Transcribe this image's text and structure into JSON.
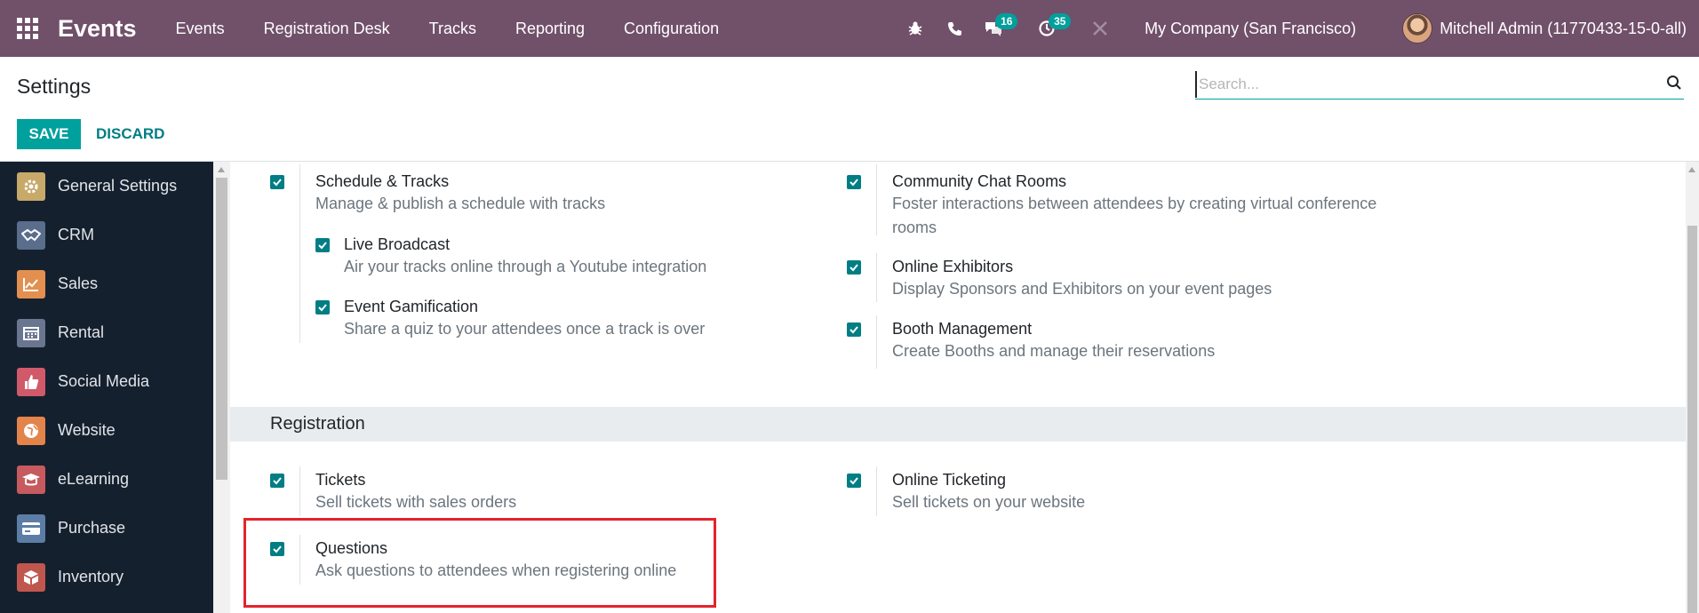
{
  "navbar": {
    "brand": "Events",
    "menu": [
      "Events",
      "Registration Desk",
      "Tracks",
      "Reporting",
      "Configuration"
    ],
    "messages_count": "16",
    "activities_count": "35",
    "company": "My Company (San Francisco)",
    "user": "Mitchell Admin (11770433-15-0-all)",
    "bg_color": "#71506a"
  },
  "control": {
    "title": "Settings",
    "search_placeholder": "Search...",
    "save_label": "SAVE",
    "discard_label": "DISCARD"
  },
  "sidebar": {
    "items": [
      {
        "label": "General Settings",
        "icon": "gear-icon",
        "color": "#c7a96a"
      },
      {
        "label": "CRM",
        "icon": "handshake-icon",
        "color": "#5a6d8c"
      },
      {
        "label": "Sales",
        "icon": "chart-icon",
        "color": "#e38f4f"
      },
      {
        "label": "Rental",
        "icon": "calendar-icon",
        "color": "#6a7590"
      },
      {
        "label": "Social Media",
        "icon": "thumbs-up-icon",
        "color": "#d05a6a"
      },
      {
        "label": "Website",
        "icon": "globe-icon",
        "color": "#e3844a"
      },
      {
        "label": "eLearning",
        "icon": "graduation-icon",
        "color": "#c65a5e"
      },
      {
        "label": "Purchase",
        "icon": "card-icon",
        "color": "#5c7ea6"
      },
      {
        "label": "Inventory",
        "icon": "box-icon",
        "color": "#c0574e"
      }
    ]
  },
  "settings": {
    "schedule_tracks": {
      "title": "Schedule & Tracks",
      "desc": "Manage & publish a schedule with tracks"
    },
    "live_broadcast": {
      "title": "Live Broadcast",
      "desc": "Air your tracks online through a Youtube integration"
    },
    "event_gamification": {
      "title": "Event Gamification",
      "desc": "Share a quiz to your attendees once a track is over"
    },
    "community_chat": {
      "title": "Community Chat Rooms",
      "desc": "Foster interactions between attendees by creating virtual conference rooms"
    },
    "online_exhibitors": {
      "title": "Online Exhibitors",
      "desc": "Display Sponsors and Exhibitors on your event pages"
    },
    "booth_management": {
      "title": "Booth Management",
      "desc": "Create Booths and manage their reservations"
    },
    "registration_header": "Registration",
    "tickets": {
      "title": "Tickets",
      "desc": "Sell tickets with sales orders"
    },
    "online_ticketing": {
      "title": "Online Ticketing",
      "desc": "Sell tickets on your website"
    },
    "questions": {
      "title": "Questions",
      "desc": "Ask questions to attendees when registering online"
    }
  },
  "colors": {
    "accent": "#017e84",
    "highlight": "#e3232c",
    "sidebar_bg": "#15202f"
  }
}
